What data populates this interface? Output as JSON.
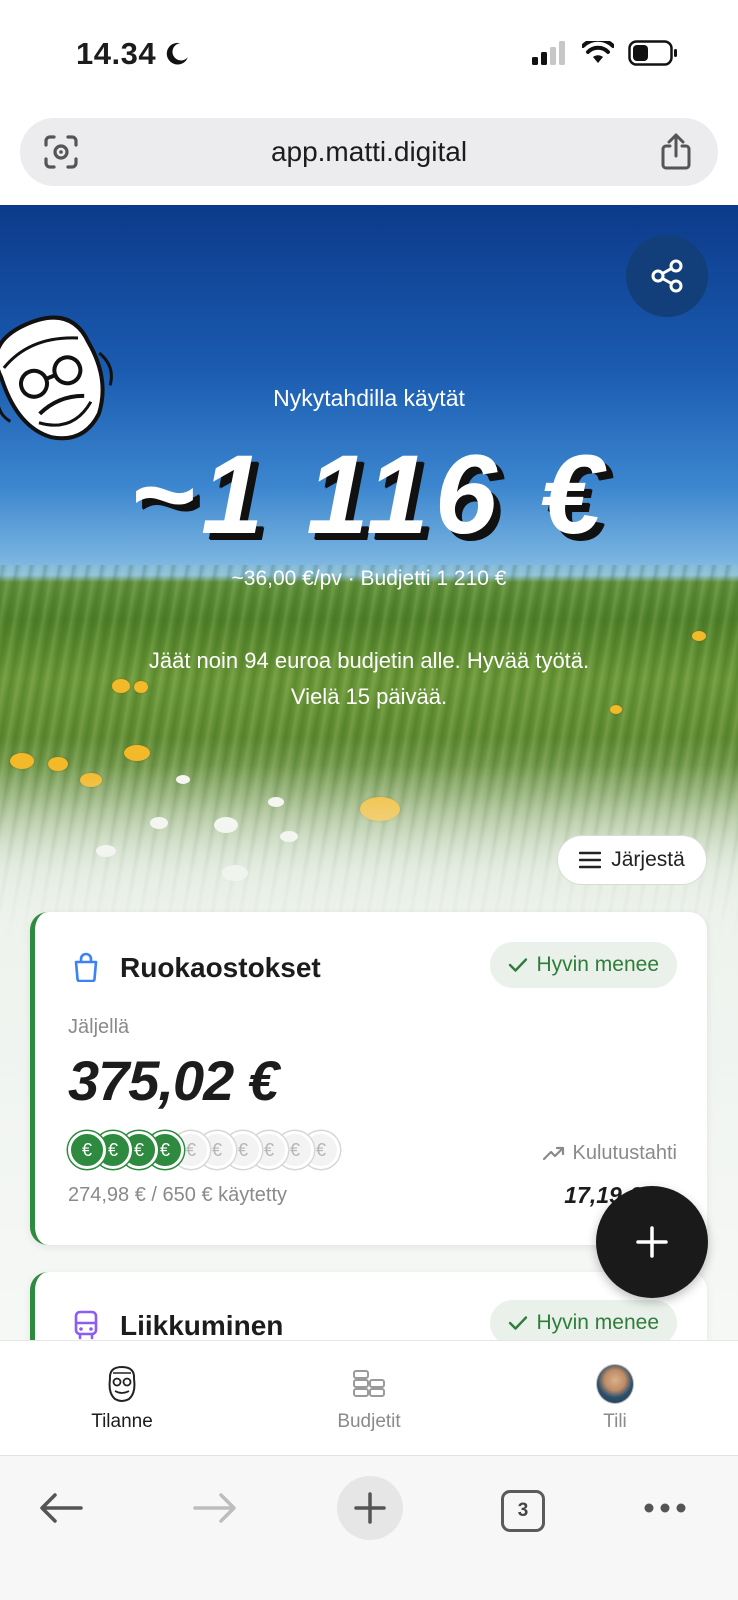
{
  "status_bar": {
    "time": "14.34",
    "icons": [
      "moon-icon",
      "signal-icon",
      "wifi-icon",
      "battery-icon"
    ]
  },
  "browser": {
    "url": "app.matti.digital",
    "icons": [
      "lens-icon",
      "share-icon"
    ],
    "toolbar": {
      "tab_count": "3",
      "icons": [
        "back-arrow-icon",
        "forward-arrow-icon",
        "new-tab-plus-icon",
        "tabs-icon",
        "more-icon"
      ]
    }
  },
  "hero": {
    "label": "Nykytahdilla käytät",
    "amount": "~1 116 €",
    "subline": "~36,00 €/pv · Budjetti 1 210 €",
    "message": "Jäät noin 94 euroa budjetin alle. Hyvää työtä. Vielä 15 päivää.",
    "share_icon": "share-nodes-icon",
    "sort_label": "Järjestä"
  },
  "budgets": [
    {
      "title": "Ruokaostokset",
      "icon": "shopping-bag-icon",
      "status": "Hyvin menee",
      "remaining_label": "Jäljellä",
      "remaining_value": "375,02 €",
      "spent_text": "274,98 € / 650 € käytetty",
      "coins_filled": 4,
      "coins_total": 10,
      "coin_symbol": "€",
      "pace_label": "Kulutustahti",
      "pace_value": "17,19 €"
    },
    {
      "title": "Liikkuminen",
      "icon": "bus-icon",
      "status": "Hyvin menee"
    }
  ],
  "fab": {
    "icon": "plus-icon"
  },
  "nav": {
    "items": [
      {
        "label": "Tilanne",
        "icon": "mascot-face-icon",
        "active": true
      },
      {
        "label": "Budjetit",
        "icon": "coin-stack-icon",
        "active": false
      },
      {
        "label": "Tili",
        "icon": "avatar",
        "active": false
      }
    ]
  },
  "colors": {
    "accent_green": "#2e8a3e",
    "status_pill_bg": "#e9f1ea",
    "status_pill_text": "#2f7d3b",
    "fab_bg": "#1a1a1a",
    "hero_share_bg": "#123f7a"
  }
}
